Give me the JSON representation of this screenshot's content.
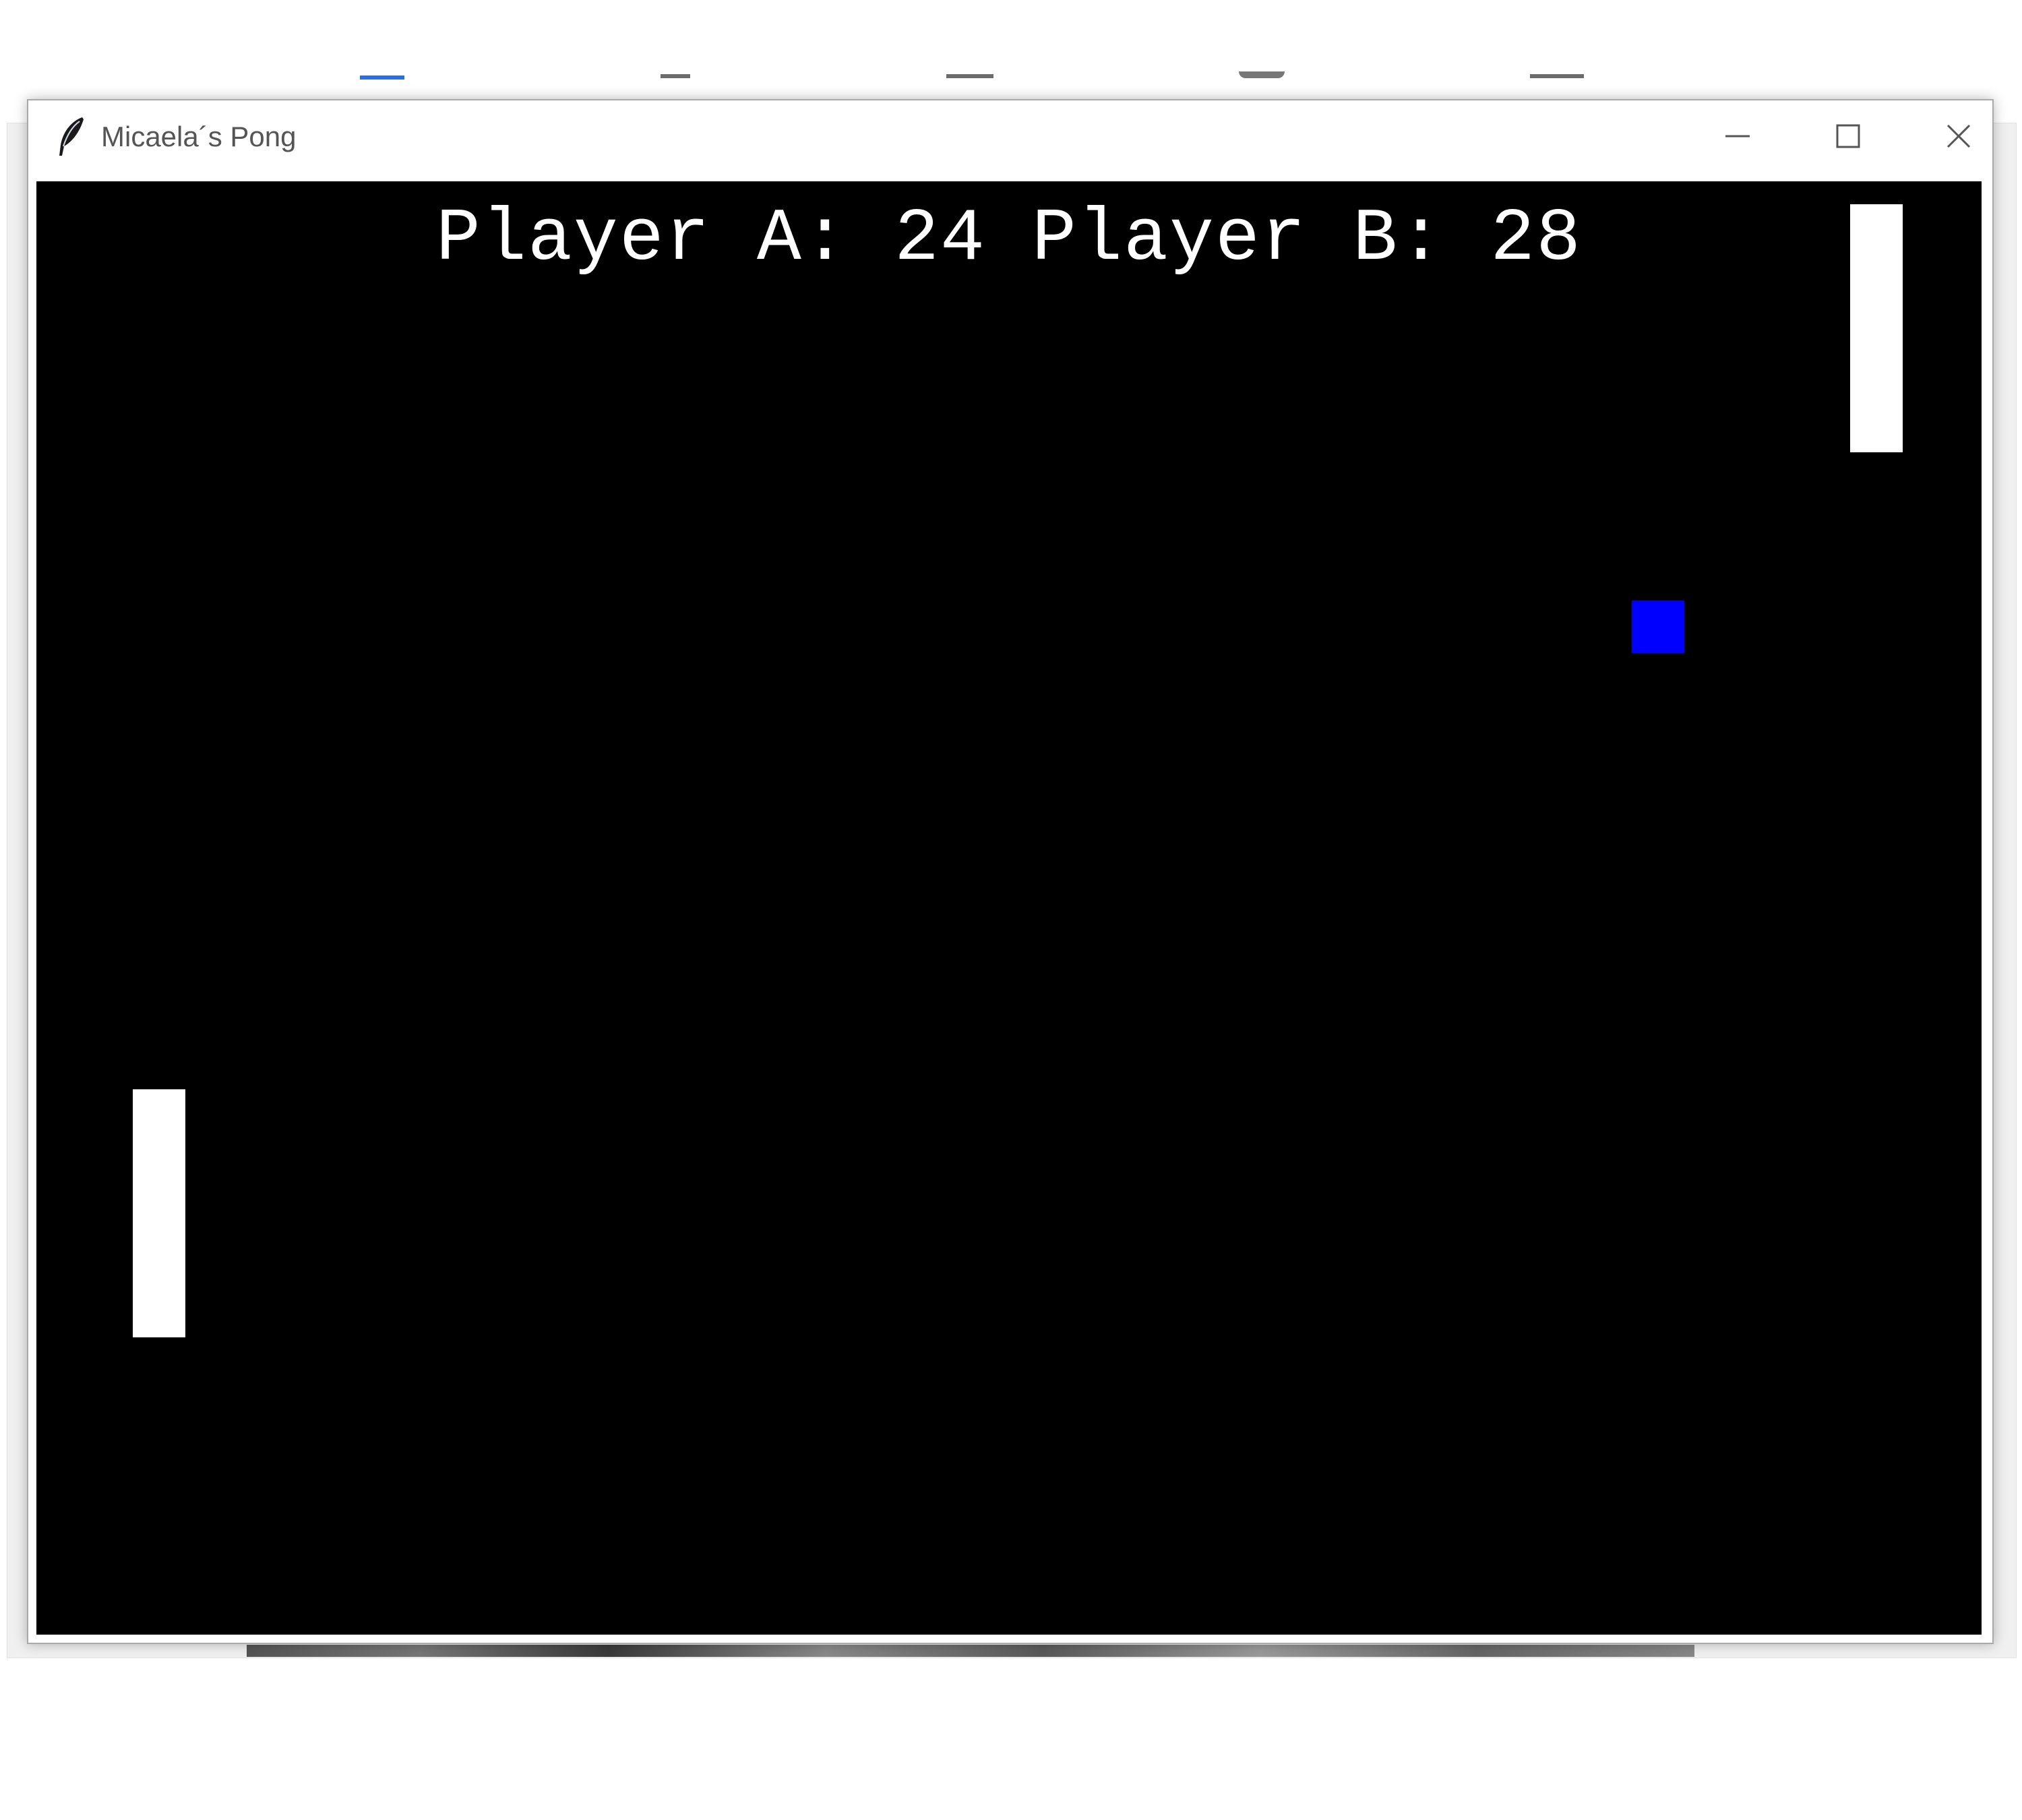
{
  "window": {
    "title": "Micaela´s Pong"
  },
  "titlebar_buttons": {
    "minimize_icon": "minimize-icon",
    "maximize_icon": "maximize-icon",
    "close_icon": "close-icon"
  },
  "app_icon": "feather-icon",
  "game": {
    "score_label_a": "Player A:",
    "score_a": "24",
    "score_label_b": "Player B:",
    "score_b": "28",
    "background_color": "#000000",
    "paddle_color": "#ffffff",
    "ball_color": "#0000ff"
  }
}
